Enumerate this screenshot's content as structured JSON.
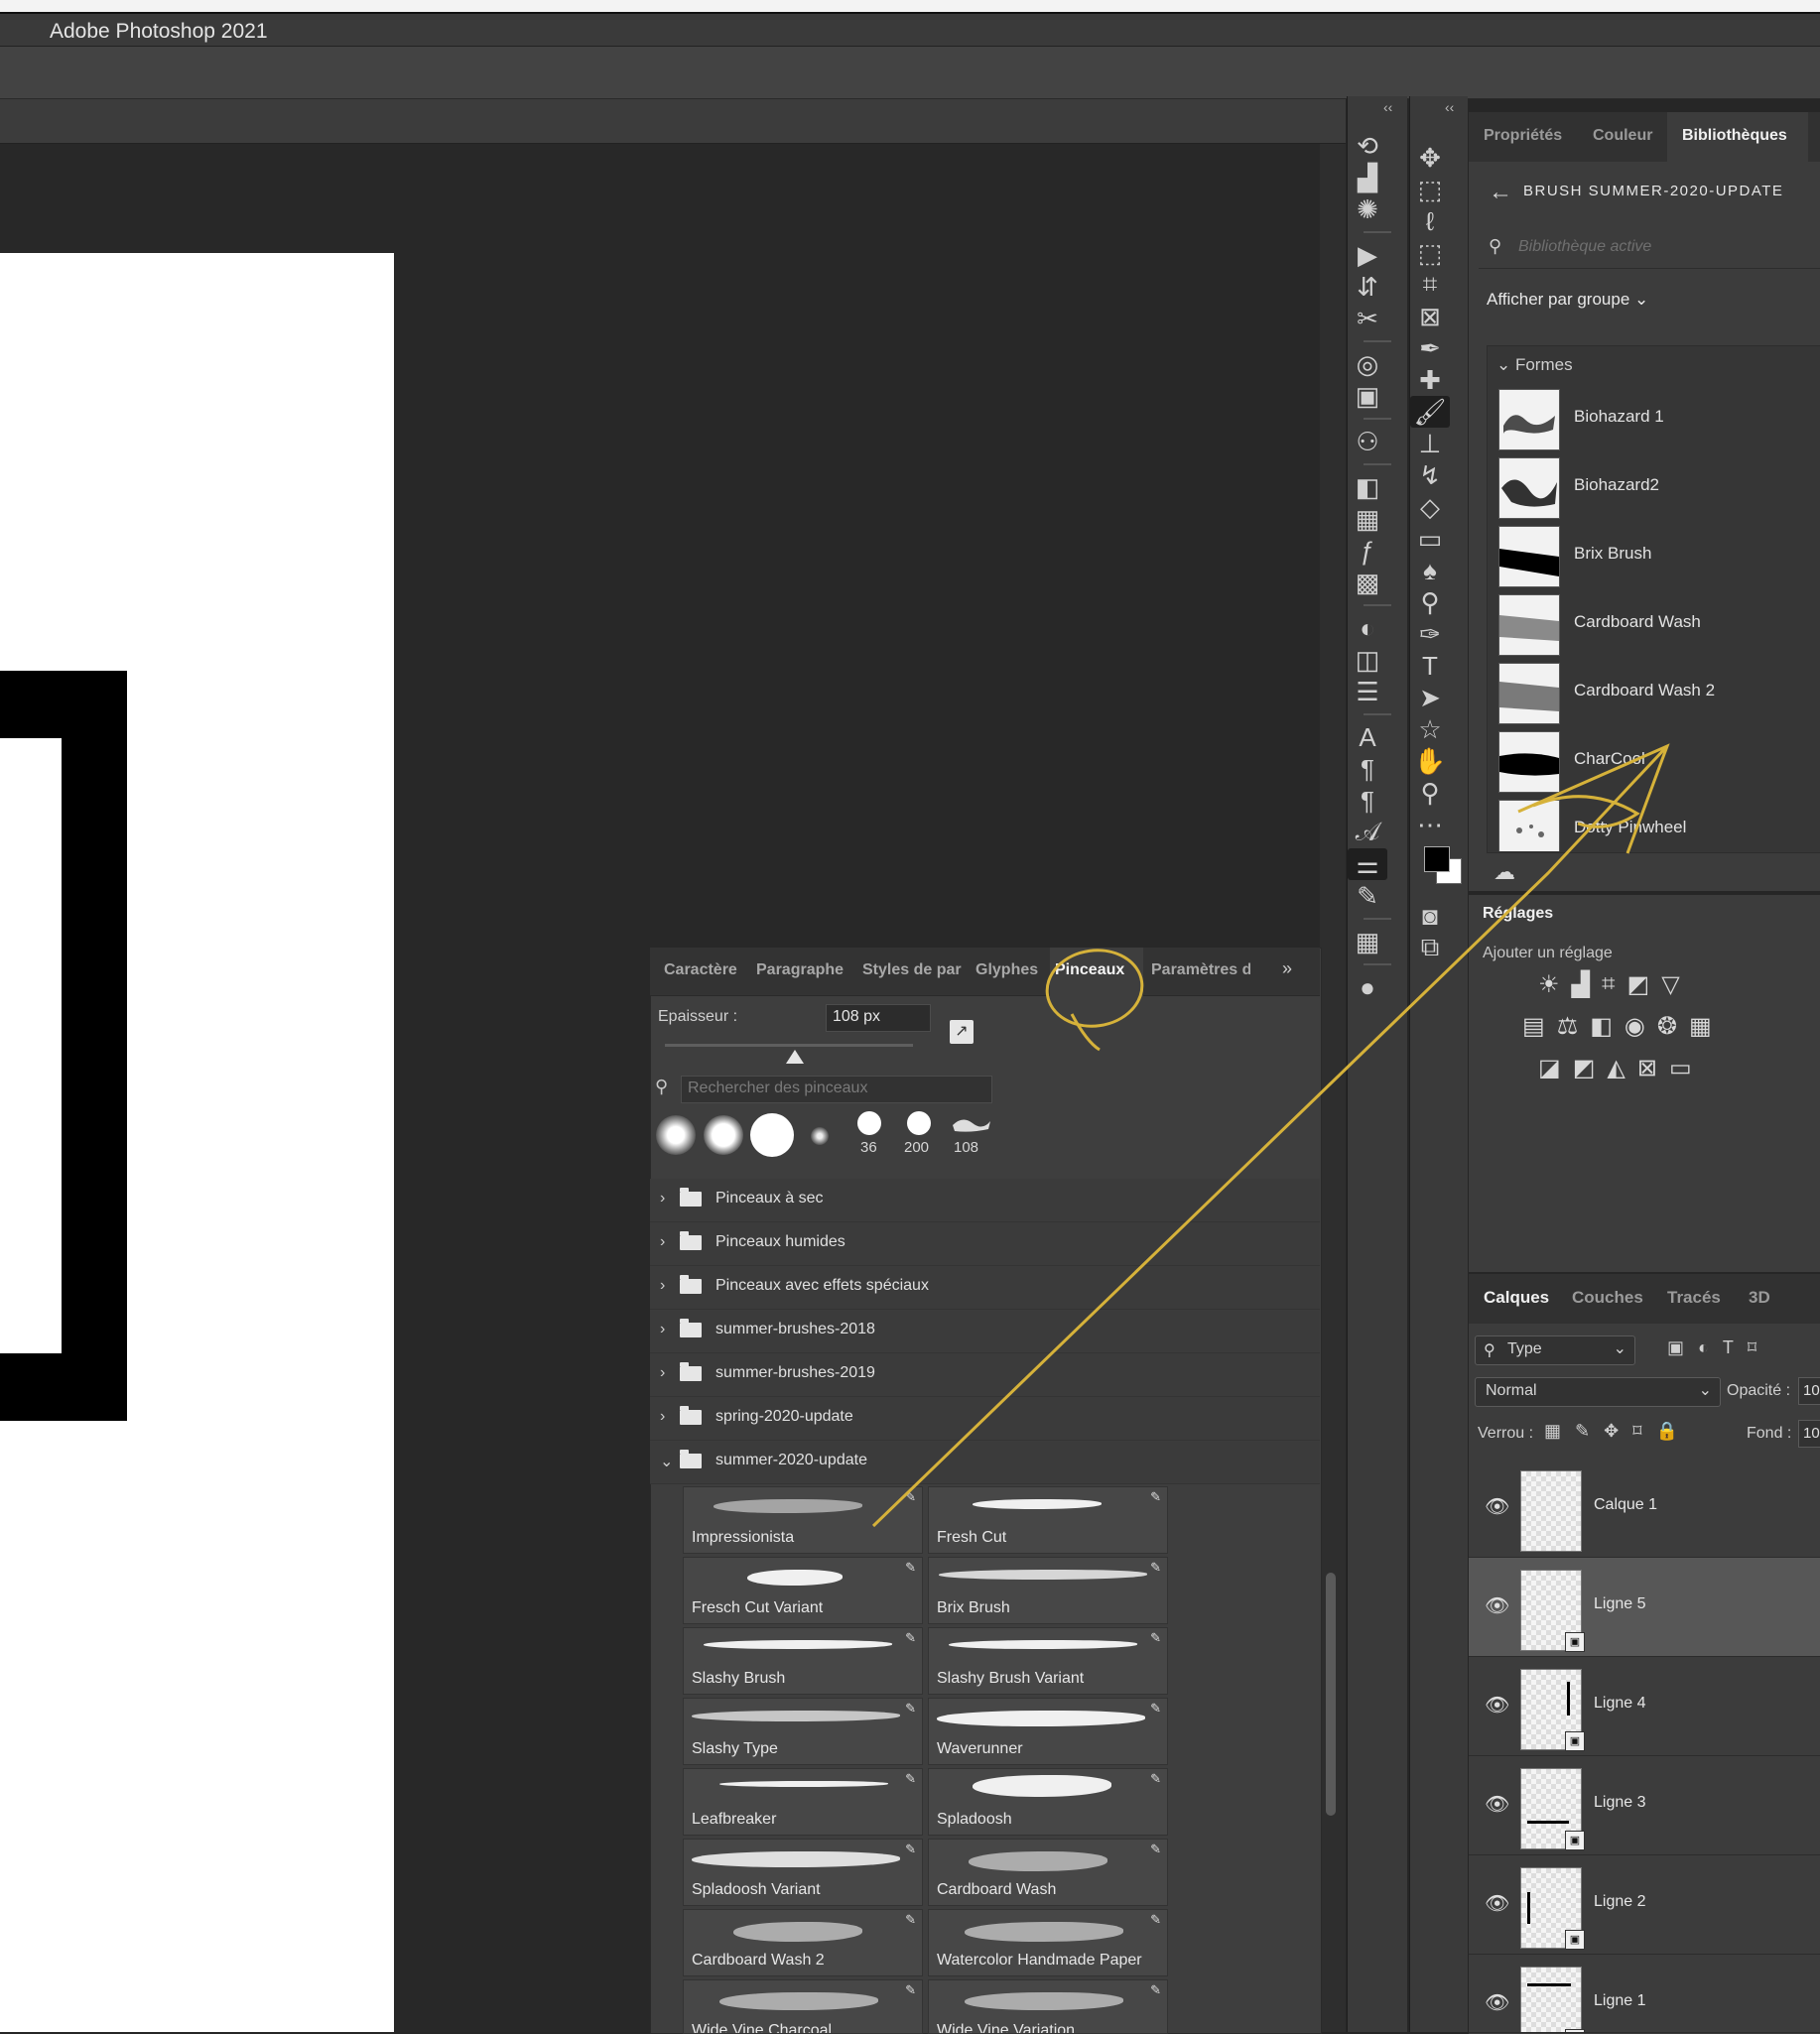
{
  "app": {
    "title": "Adobe Photoshop 2021"
  },
  "right_panel": {
    "tabs": [
      "Propriétés",
      "Couleur",
      "Bibliothèques"
    ],
    "active_tab": "Bibliothèques",
    "library_title": "BRUSH SUMMER-2020-UPDATE",
    "search_placeholder": "Bibliothèque active",
    "group_by": "Afficher par groupe",
    "section": "Formes",
    "items": [
      {
        "name": "Biohazard 1"
      },
      {
        "name": "Biohazard2"
      },
      {
        "name": "Brix Brush"
      },
      {
        "name": "Cardboard Wash"
      },
      {
        "name": "Cardboard Wash 2"
      },
      {
        "name": "CharCool"
      },
      {
        "name": "Dotty Pinwheel"
      }
    ]
  },
  "adjustments": {
    "title": "Réglages",
    "subtitle": "Ajouter un réglage"
  },
  "layers_panel": {
    "tabs": [
      "Calques",
      "Couches",
      "Tracés",
      "3D"
    ],
    "active_tab": "Calques",
    "filter": "Type",
    "blend_mode": "Normal",
    "opacity_label": "Opacité :",
    "opacity_value": "10",
    "lock_label": "Verrou :",
    "fill_label": "Fond :",
    "fill_value": "10",
    "layers": [
      {
        "name": "Calque 1",
        "selected": false
      },
      {
        "name": "Ligne 5",
        "selected": true
      },
      {
        "name": "Ligne 4",
        "selected": false
      },
      {
        "name": "Ligne 3",
        "selected": false
      },
      {
        "name": "Ligne 2",
        "selected": false
      },
      {
        "name": "Ligne 1",
        "selected": false
      }
    ]
  },
  "brushes_panel": {
    "tabs": [
      "Caractère",
      "Paragraphe",
      "Styles de par",
      "Glyphes",
      "Pinceaux",
      "Paramètres d"
    ],
    "active_tab": "Pinceaux",
    "size_label": "Epaisseur :",
    "size_value": "108 px",
    "search_placeholder": "Rechercher des pinceaux",
    "recent_tip_sizes": [
      "36",
      "200",
      "108"
    ],
    "folders": [
      {
        "name": "Pinceaux à sec",
        "open": false
      },
      {
        "name": "Pinceaux humides",
        "open": false
      },
      {
        "name": "Pinceaux avec effets spéciaux",
        "open": false
      },
      {
        "name": "summer-brushes-2018",
        "open": false
      },
      {
        "name": "summer-brushes-2019",
        "open": false
      },
      {
        "name": "spring-2020-update",
        "open": false
      },
      {
        "name": "summer-2020-update",
        "open": true
      }
    ],
    "brushes": [
      "Impressionista",
      "Fresh Cut",
      "Fresch Cut Variant",
      "Brix Brush",
      "Slashy Brush",
      "Slashy Brush Variant",
      "Slashy Type",
      "Waverunner",
      "Leafbreaker",
      "Spladoosh",
      "Spladoosh Variant",
      "Cardboard Wash",
      "Cardboard Wash 2",
      "Watercolor Handmade Paper",
      "Wide Vine Charcoal",
      "Wide Vine Variation"
    ]
  },
  "annotation": {
    "color": "#d6b23a"
  }
}
